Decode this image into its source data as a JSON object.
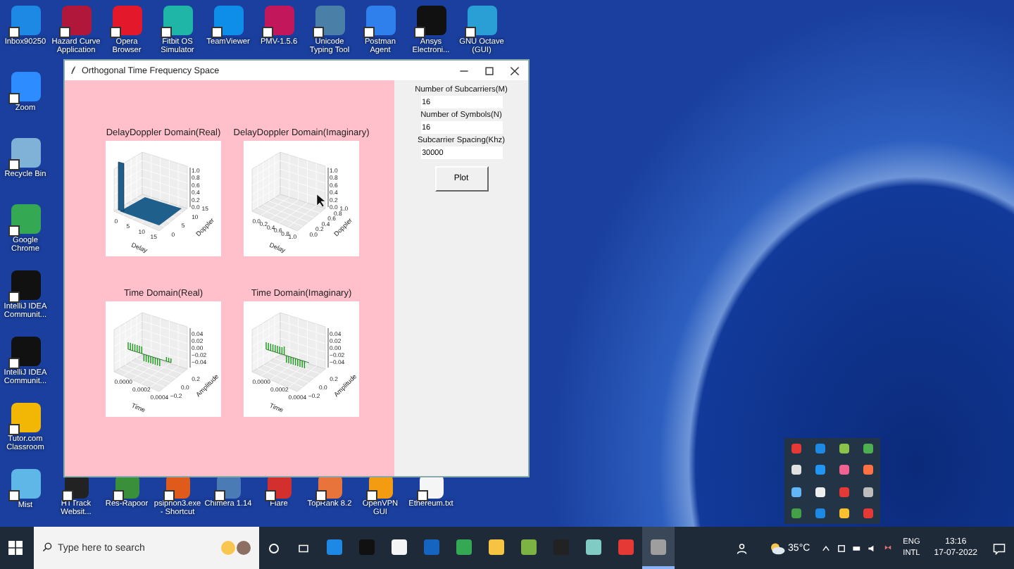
{
  "desktop": {
    "top_row": [
      {
        "label": "Inbox90250",
        "color": "#1e88e5"
      },
      {
        "label": "Hazard Curve Application",
        "color": "#b0173a"
      },
      {
        "label": "Opera Browser",
        "color": "#e3192b"
      },
      {
        "label": "Fitbit OS Simulator",
        "color": "#1fb6a8"
      },
      {
        "label": "TeamViewer",
        "color": "#0e8ee9"
      },
      {
        "label": "PMV-1.5.6",
        "color": "#c2185b"
      },
      {
        "label": "Unicode Typing Tool",
        "color": "#4a7fa8"
      },
      {
        "label": "Postman Agent",
        "color": "#2f80ed"
      },
      {
        "label": "Ansys Electroni...",
        "color": "#111111"
      },
      {
        "label": "GNU Octave (GUI)",
        "color": "#2a9fd6"
      }
    ],
    "left_column": [
      {
        "label": "Zoom",
        "color": "#2d8cff"
      },
      {
        "label": "Recycle Bin",
        "color": "#7fb2d6"
      },
      {
        "label": "Google Chrome",
        "color": "#34a853"
      },
      {
        "label": "IntelliJ IDEA Communit...",
        "color": "#111111"
      },
      {
        "label": "IntelliJ IDEA Communit...",
        "color": "#111111"
      },
      {
        "label": "Tutor.com Classroom",
        "color": "#f2b705"
      },
      {
        "label": "Mist",
        "color": "#5fb7e8"
      }
    ],
    "bottom_row": [
      {
        "label": "HTTrack Websit...",
        "color": "#222222"
      },
      {
        "label": "Res-Rapoor",
        "color": "#3a8f3a"
      },
      {
        "label": "psiphon3.exe - Shortcut",
        "color": "#e05a1c"
      },
      {
        "label": "Chimera 1.14",
        "color": "#4b7bb5"
      },
      {
        "label": "Flare",
        "color": "#d32f2f"
      },
      {
        "label": "TopRank 8.2",
        "color": "#e8743b"
      },
      {
        "label": "OpenVPN GUI",
        "color": "#f39c12"
      },
      {
        "label": "Ethereum.txt",
        "color": "#f5f5f5"
      }
    ]
  },
  "window": {
    "title": "Orthogonal Time Frequency Space",
    "plots": [
      {
        "kind": "bar3d",
        "title": "DelayDoppler Domain(Real)",
        "zticks": [
          "1.0",
          "0.8",
          "0.6",
          "0.4",
          "0.2",
          "0.0"
        ],
        "xticks": [
          "0",
          "5",
          "10",
          "15"
        ],
        "yticks": [
          "0",
          "5",
          "10",
          "15"
        ],
        "xlabel": "Delay",
        "ylabel": "Doppler"
      },
      {
        "kind": "empty",
        "title": "DelayDoppler Domain(Imaginary)",
        "zticks": [
          "1.0",
          "0.8",
          "0.6",
          "0.4",
          "0.2",
          "0.0"
        ],
        "xticks": [
          "0.0",
          "0.2",
          "0.4",
          "0.6",
          "0.8",
          "1.0"
        ],
        "yticks": [
          "0.0",
          "0.2",
          "0.4",
          "0.6",
          "0.8",
          "1.0"
        ],
        "xlabel": "Delay",
        "ylabel": "Doppler"
      },
      {
        "kind": "stem3d",
        "title": "Time Domain(Real)",
        "zticks": [
          "0.04",
          "0.02",
          "0.00",
          "−0.02",
          "−0.04"
        ],
        "xticks": [
          "0.0000",
          "0.0002",
          "0.0004"
        ],
        "yticks": [
          "−0.2",
          "0.0",
          "0.2"
        ],
        "xlabel": "Time",
        "ylabel": "Amplitude"
      },
      {
        "kind": "stem3d",
        "title": "Time Domain(Imaginary)",
        "zticks": [
          "0.04",
          "0.02",
          "0.00",
          "−0.02",
          "−0.04"
        ],
        "xticks": [
          "0.0000",
          "0.0002",
          "0.0004"
        ],
        "yticks": [
          "−0.2",
          "0.0",
          "0.2"
        ],
        "xlabel": "Time",
        "ylabel": "Amplitude"
      }
    ],
    "fields": [
      {
        "label": "Number of Subcarriers(M)",
        "value": "16"
      },
      {
        "label": "Number of Symbols(N)",
        "value": "16"
      },
      {
        "label": "Subcarrier Spacing(Khz)",
        "value": "30000"
      }
    ],
    "button": "Plot"
  },
  "tray_popup": [
    {
      "color": "#e53935"
    },
    {
      "color": "#1e88e5"
    },
    {
      "color": "#8bc34a"
    },
    {
      "color": "#4caf50"
    },
    {
      "color": "#e0e0e0"
    },
    {
      "color": "#2196f3"
    },
    {
      "color": "#f06292"
    },
    {
      "color": "#ff7043"
    },
    {
      "color": "#64b5f6"
    },
    {
      "color": "#eeeeee"
    },
    {
      "color": "#e53935"
    },
    {
      "color": "#bdbdbd"
    },
    {
      "color": "#43a047"
    },
    {
      "color": "#1e88e5"
    },
    {
      "color": "#fbc02d"
    },
    {
      "color": "#e53935"
    }
  ],
  "taskbar": {
    "search_placeholder": "Type here to search",
    "apps": [
      {
        "color": "#1e88e5",
        "active": false
      },
      {
        "color": "#111111",
        "active": false
      },
      {
        "color": "#f5f5f5",
        "active": false
      },
      {
        "color": "#1565c0",
        "active": false
      },
      {
        "color": "#34a853",
        "active": false
      },
      {
        "color": "#f6c343",
        "active": false
      },
      {
        "color": "#7cb342",
        "active": false
      },
      {
        "color": "#222222",
        "active": false
      },
      {
        "color": "#80cbc4",
        "active": false
      },
      {
        "color": "#e53935",
        "active": false
      },
      {
        "color": "#9e9e9e",
        "active": true
      }
    ],
    "temperature": "35°C",
    "language": "ENG",
    "layout": "INTL",
    "time": "13:16",
    "date": "17-07-2022"
  }
}
